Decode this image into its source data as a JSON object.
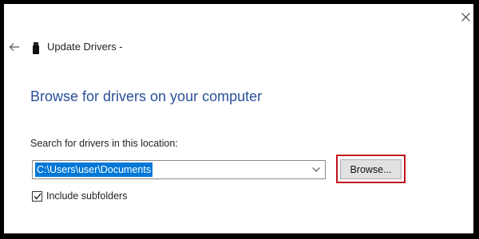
{
  "window": {
    "title": "Update Drivers -",
    "close_icon": "close-icon",
    "back_icon": "back-arrow-icon",
    "device_icon": "usb-device-icon"
  },
  "page": {
    "heading": "Browse for drivers on your computer",
    "search_label": "Search for drivers in this location:",
    "path_value": "C:\\Users\\user\\Documents",
    "browse_label": "Browse...",
    "include_subfolders_label": "Include subfolders",
    "include_subfolders_checked": true
  },
  "colors": {
    "heading": "#2a4f9a",
    "selection": "#0078d7",
    "highlight_border": "#c1121f"
  }
}
